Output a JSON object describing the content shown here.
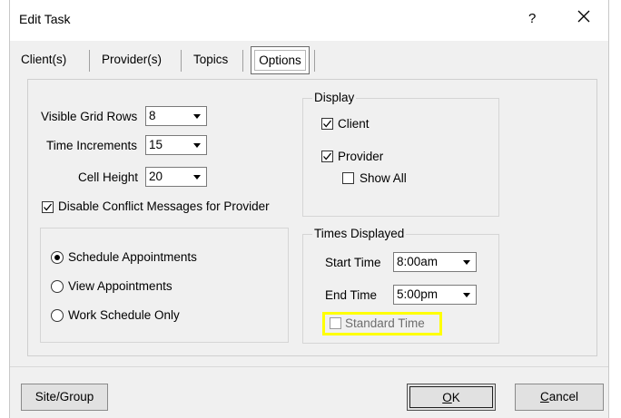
{
  "window": {
    "title": "Edit Task",
    "help_label": "?",
    "close_icon": "close-icon"
  },
  "tabs": [
    {
      "label": "Client(s)"
    },
    {
      "label": "Provider(s)"
    },
    {
      "label": "Topics"
    },
    {
      "label": "Options",
      "active": true
    }
  ],
  "options": {
    "visible_grid_rows": {
      "label": "Visible Grid Rows",
      "value": "8"
    },
    "time_increments": {
      "label": "Time Increments",
      "value": "15"
    },
    "cell_height": {
      "label": "Cell Height",
      "value": "20"
    },
    "disable_conflict": {
      "label": "Disable Conflict Messages for Provider",
      "checked": true
    },
    "mode": {
      "options": [
        "Schedule Appointments",
        "View Appointments",
        "Work Schedule Only"
      ],
      "selected": "Schedule Appointments"
    }
  },
  "display": {
    "legend": "Display",
    "client": {
      "label": "Client",
      "checked": true
    },
    "provider": {
      "label": "Provider",
      "checked": true
    },
    "show_all": {
      "label": "Show All",
      "checked": false
    }
  },
  "times_displayed": {
    "legend": "Times Displayed",
    "start_time": {
      "label": "Start Time",
      "value": "8:00am"
    },
    "end_time": {
      "label": "End Time",
      "value": "5:00pm"
    },
    "standard_time": {
      "label": "Standard Time",
      "checked": false,
      "enabled": false,
      "highlight_color": "#ffff00"
    }
  },
  "buttons": {
    "site_group": "Site/Group",
    "ok_accel": "O",
    "ok_rest": "K",
    "cancel_accel": "C",
    "cancel_rest": "ancel"
  }
}
